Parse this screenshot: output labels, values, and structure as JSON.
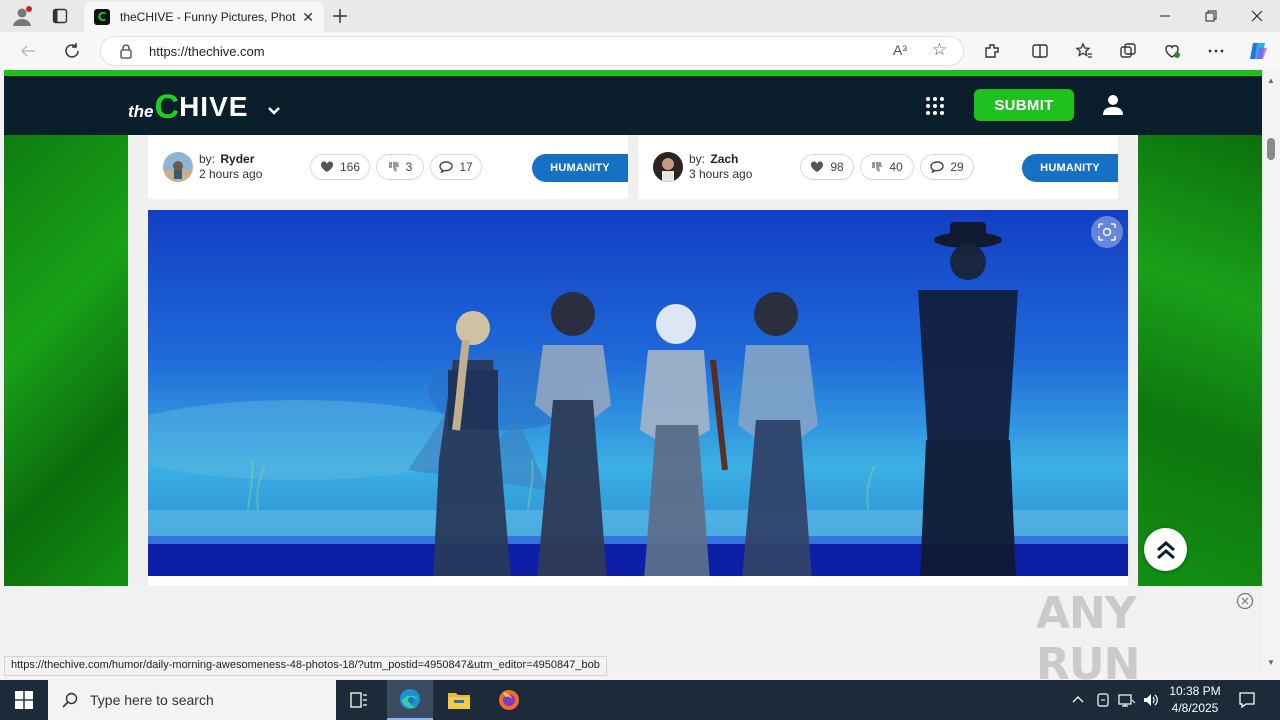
{
  "browser": {
    "tab_title": "theCHIVE - Funny Pictures, Photos",
    "favicon_letter": "C",
    "url": "https://thechive.com",
    "read_aloud": "A³",
    "status_url": "https://thechive.com/humor/daily-morning-awesomeness-48-photos-18/?utm_postid=4950847&utm_editor=4950847_bob"
  },
  "site": {
    "logo_the": "the",
    "logo_c": "C",
    "logo_hive": "HIVE",
    "submit_label": "SUBMIT",
    "accent_green": "#1fc11f",
    "header_bg": "#0a1e2b",
    "tag_blue": "#1670c4"
  },
  "cards": [
    {
      "by_label": "by:",
      "author": "Ryder",
      "time": "2 hours ago",
      "likes": "166",
      "dislikes": "3",
      "comments": "17",
      "tag": "HUMANITY"
    },
    {
      "by_label": "by:",
      "author": "Zach",
      "time": "3 hours ago",
      "likes": "98",
      "dislikes": "40",
      "comments": "29",
      "tag": "HUMANITY"
    }
  ],
  "watermark": "ANY RUN",
  "taskbar": {
    "search_placeholder": "Type here to search",
    "time": "10:38 PM",
    "date": "4/8/2025"
  }
}
